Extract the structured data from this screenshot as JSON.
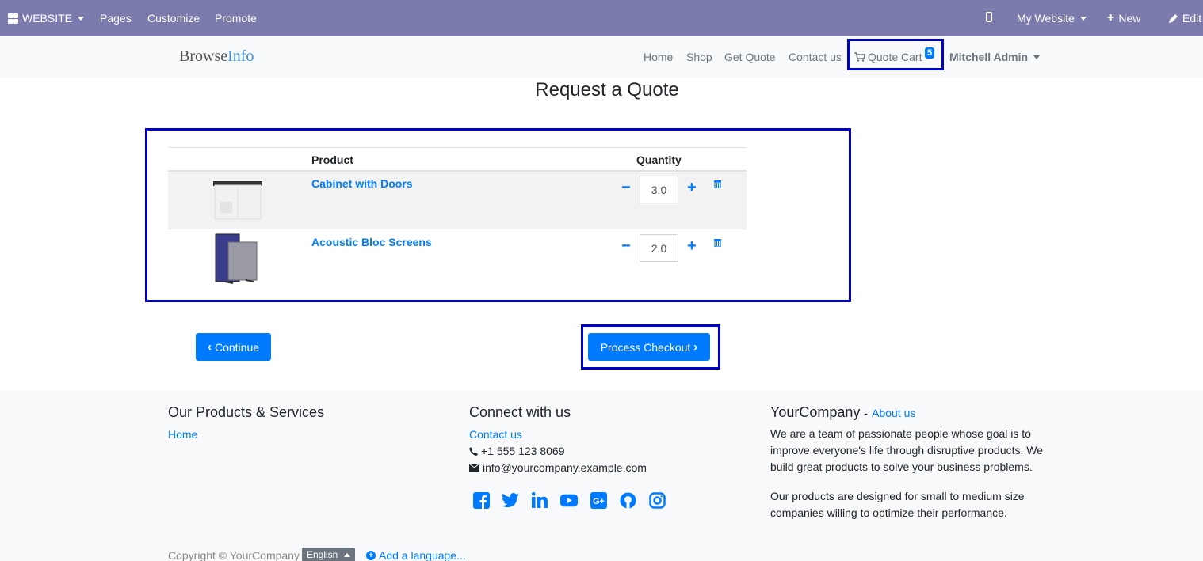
{
  "admin_bar": {
    "website_label": "WEBSITE",
    "pages_label": "Pages",
    "customize_label": "Customize",
    "promote_label": "Promote",
    "my_website_label": "My Website",
    "new_label": "New",
    "edit_label": "Edit"
  },
  "navbar": {
    "brand_part1": "Browse",
    "brand_part2": "Info",
    "links": [
      "Home",
      "Shop",
      "Get Quote",
      "Contact us"
    ],
    "cart_label": "Quote Cart",
    "cart_count": "5",
    "user_label": "Mitchell Admin"
  },
  "main": {
    "title": "Request a Quote",
    "table": {
      "headers": [
        "Product",
        "Quantity"
      ],
      "rows": [
        {
          "name": "Cabinet with Doors",
          "quantity": "3.0"
        },
        {
          "name": "Acoustic Bloc Screens",
          "quantity": "2.0"
        }
      ]
    },
    "continue_label": "Continue",
    "checkout_label": "Process Checkout"
  },
  "footer": {
    "col1_title": "Our Products & Services",
    "col1_link": "Home",
    "col2_title": "Connect with us",
    "col2_link": "Contact us",
    "phone": "+1 555 123 8069",
    "email": "info@yourcompany.example.com",
    "col3_title": "YourCompany",
    "col3_sep": "-",
    "col3_link": "About us",
    "para1": "We are a team of passionate people whose goal is to improve everyone's life through disruptive products. We build great products to solve your business problems.",
    "para2": "Our products are designed for small to medium size companies willing to optimize their performance.",
    "copyright": "Copyright © YourCompany",
    "language": "English",
    "add_language": "Add a language..."
  },
  "colors": {
    "admin_bar": "#7c7bad",
    "primary": "#007bff",
    "highlight": "#0000cc"
  },
  "icons": [
    "apps-grid-icon",
    "phone-icon",
    "plus-icon",
    "pencil-icon",
    "cart-icon",
    "minus-icon",
    "trash-icon",
    "chevron-left-icon",
    "chevron-right-icon",
    "facebook-icon",
    "twitter-icon",
    "linkedin-icon",
    "youtube-icon",
    "google-plus-icon",
    "github-icon",
    "instagram-icon"
  ]
}
